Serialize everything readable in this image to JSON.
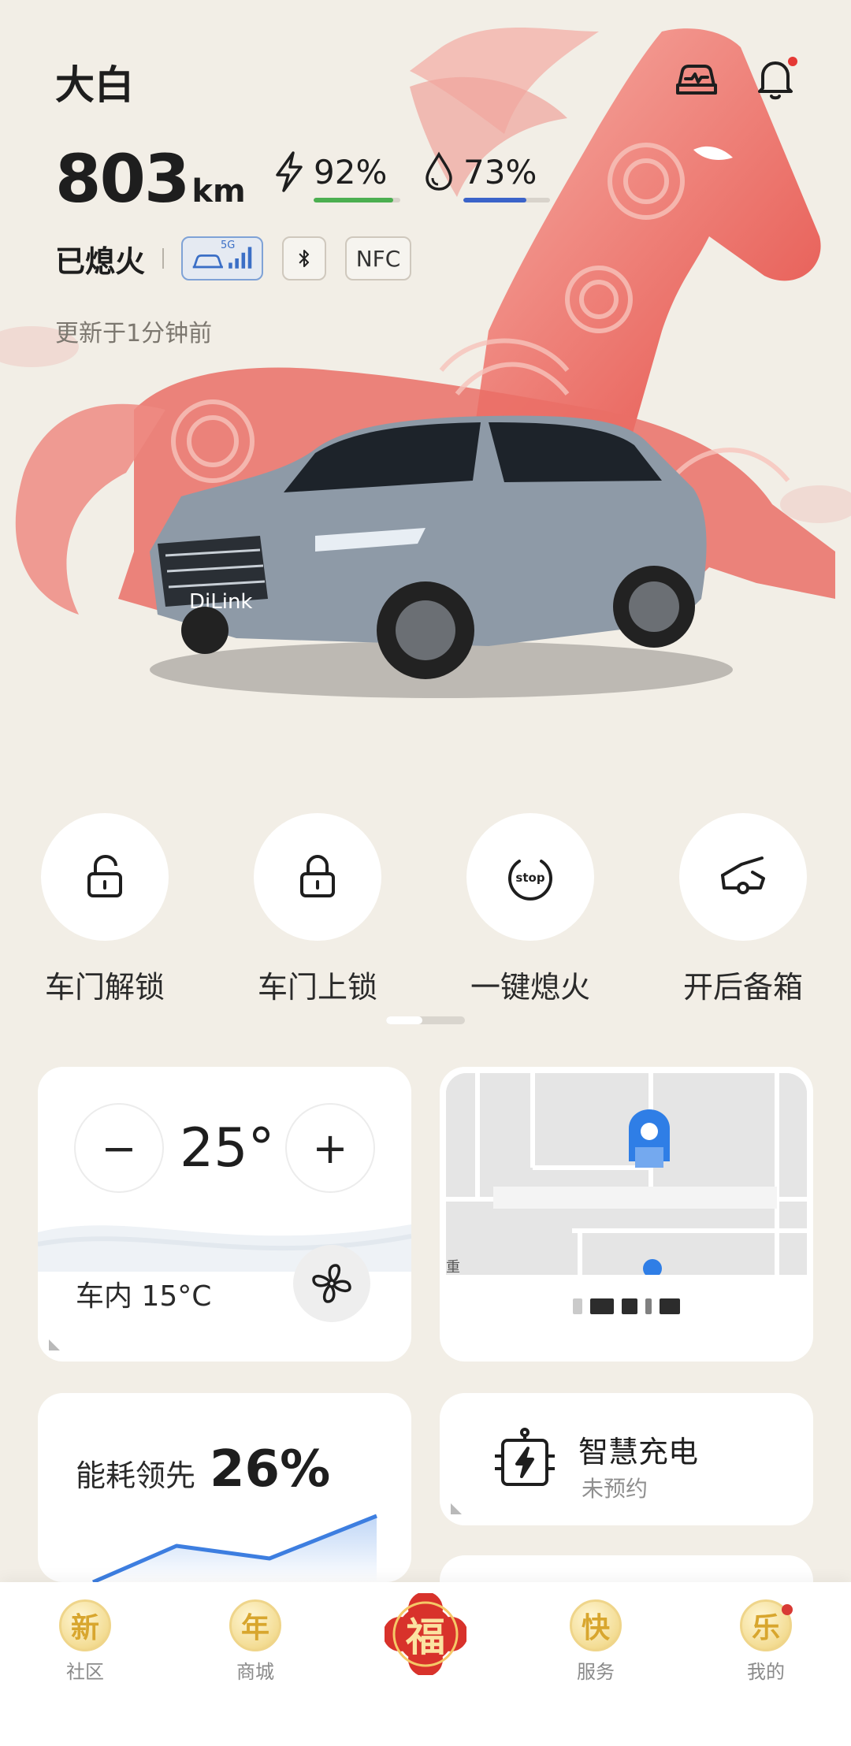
{
  "header": {
    "car_name": "大白",
    "range_value": "803",
    "range_unit": "km",
    "battery_pct": "92%",
    "battery_level": 0.92,
    "fuel_pct": "73%",
    "fuel_level": 0.73,
    "engine_state": "已熄火",
    "signal_tag": "5G",
    "nfc_label": "NFC",
    "updated": "更新于1分钟前",
    "icons": [
      "car-check-icon",
      "bell-icon"
    ]
  },
  "actions": [
    {
      "label": "车门解锁",
      "icon": "unlock-icon"
    },
    {
      "label": "车门上锁",
      "icon": "lock-icon"
    },
    {
      "label": "一键熄火",
      "icon": "stop-icon",
      "icon_text": "stop"
    },
    {
      "label": "开后备箱",
      "icon": "trunk-icon"
    }
  ],
  "climate": {
    "minus": "−",
    "temp": "25°",
    "plus": "+",
    "inside": "车内 15°C"
  },
  "map": {
    "street_fragment": "重"
  },
  "energy": {
    "label": "能耗领先",
    "value": "26%"
  },
  "charging": {
    "title": "智慧充电",
    "status": "未预约"
  },
  "tabbar": [
    {
      "glyph": "新",
      "label": "社区"
    },
    {
      "glyph": "年",
      "label": "商城"
    },
    {
      "glyph": "福",
      "label": ""
    },
    {
      "glyph": "快",
      "label": "服务"
    },
    {
      "glyph": "乐",
      "label": "我的"
    }
  ],
  "colors": {
    "background": "#f2eee6",
    "horse_red": "#e5554d",
    "battery_bar": "#4caf50",
    "fuel_bar": "#3b63c9",
    "map_pin": "#2f7ee6"
  }
}
